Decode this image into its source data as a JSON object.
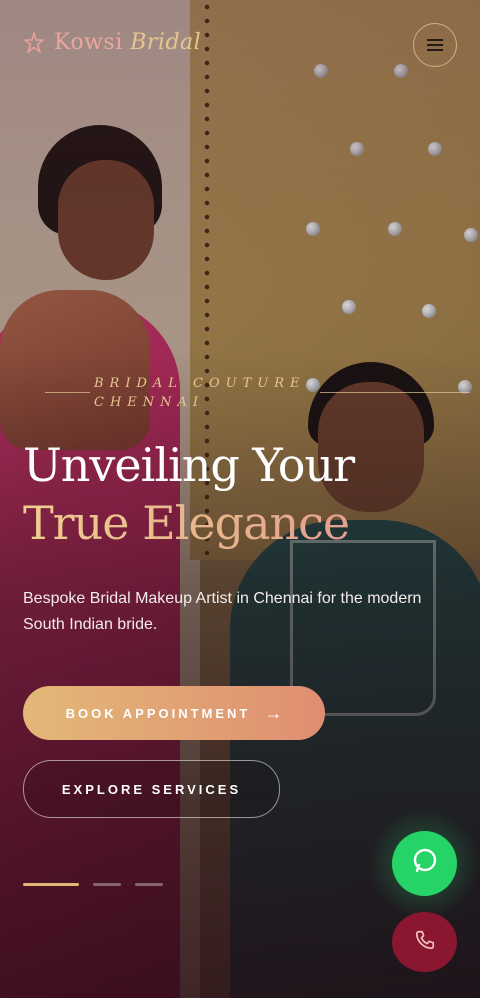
{
  "header": {
    "brand_main": "Kowsi",
    "brand_accent": "Bridal",
    "brand_icon": "sparkle-flower-icon",
    "menu_icon": "hamburger-menu-icon"
  },
  "hero": {
    "eyebrow": "BRIDAL COUTURE CHENNAI",
    "headline_line1": "Unveiling Your",
    "headline_line2": "True Elegance",
    "subtitle": "Bespoke Bridal Makeup Artist in Chennai for the modern South Indian bride.",
    "primary_cta": "BOOK APPOINTMENT",
    "primary_cta_icon": "arrow-right-icon",
    "secondary_cta": "EXPLORE SERVICES",
    "slides": {
      "count": 3,
      "active": 1
    }
  },
  "floating": {
    "whatsapp_icon": "whatsapp-icon",
    "call_icon": "phone-icon"
  },
  "colors": {
    "accent_gold": "#e2b877",
    "accent_rose": "#e08e72",
    "whatsapp_green": "#25d366",
    "call_maroon": "#8b1630"
  }
}
